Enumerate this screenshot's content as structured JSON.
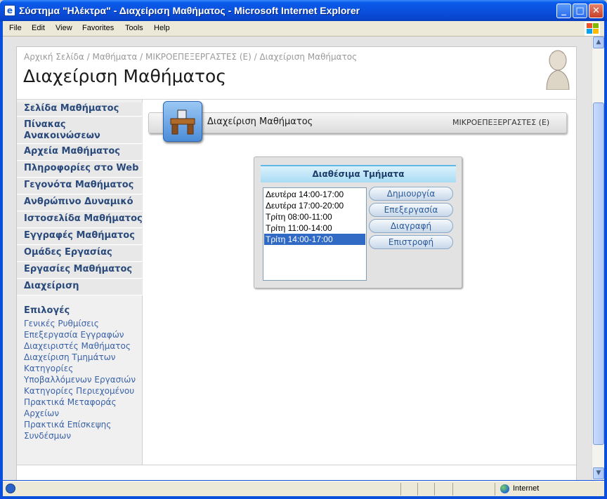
{
  "window": {
    "title": "Σύστημα \"Ηλέκτρα\" - Διαχείριση Μαθήματος - Microsoft Internet Explorer",
    "minimize": "_",
    "maximize": "□",
    "close": "✕"
  },
  "menubar": {
    "items": [
      "File",
      "Edit",
      "View",
      "Favorites",
      "Tools",
      "Help"
    ]
  },
  "page": {
    "breadcrumb": "Αρχική Σελίδα / Μαθήματα / ΜΙΚΡΟΕΠΕΞΕΡΓΑΣΤΕΣ (Ε) / Διαχείριση Μαθήματος",
    "title": "Διαχείριση Μαθήματος"
  },
  "sidebar": {
    "items": [
      {
        "label": "Σελίδα Μαθήματος"
      },
      {
        "label": "Πίνακας Ανακοινώσεων"
      },
      {
        "label": "Αρχεία Μαθήματος"
      },
      {
        "label": "Πληροφορίες στο Web"
      },
      {
        "label": "Γεγονότα Μαθήματος"
      },
      {
        "label": "Ανθρώπινο Δυναμικό"
      },
      {
        "label": "Ιστοσελίδα Μαθήματος"
      },
      {
        "label": "Εγγραφές Μαθήματος"
      },
      {
        "label": "Ομάδες Εργασίας"
      },
      {
        "label": "Εργασίες Μαθήματος"
      },
      {
        "label": "Διαχείριση"
      }
    ],
    "options_title": "Επιλογές",
    "options": [
      "Γενικές Ρυθμίσεις",
      "Επεξεργασία Εγγραφών",
      "Διαχειριστές Μαθήματος",
      "Διαχείριση Τμημάτων",
      "Κατηγορίες Υποβαλλόμενων Εργασιών",
      "Κατηγορίες Περιεχομένου",
      "Πρακτικά Μεταφοράς Αρχείων",
      "Πρακτικά Επίσκεψης Συνδέσμων"
    ]
  },
  "section": {
    "title": "Διαχείριση Μαθήματος",
    "course": "ΜΙΚΡΟΕΠΕΞΕΡΓΑΣΤΕΣ (Ε)"
  },
  "panel": {
    "title": "Διαθέσιμα Τμήματα",
    "slots": [
      "Δευτέρα 14:00-17:00",
      "Δευτέρα 17:00-20:00",
      "Τρίτη 08:00-11:00",
      "Τρίτη 11:00-14:00",
      "Τρίτη 14:00-17:00"
    ],
    "selected_slot": "Τρίτη 14:00-17:00",
    "buttons": {
      "create": "Δημιουργία",
      "edit": "Επεξεργασία",
      "delete": "Διαγραφή",
      "back": "Επιστροφή"
    }
  },
  "statusbar": {
    "zone": "Internet"
  },
  "colors": {
    "accent": "#2a4a7c",
    "link": "#3a62a8",
    "selection": "#316ac5",
    "titlebar": "#0a4fdc"
  }
}
